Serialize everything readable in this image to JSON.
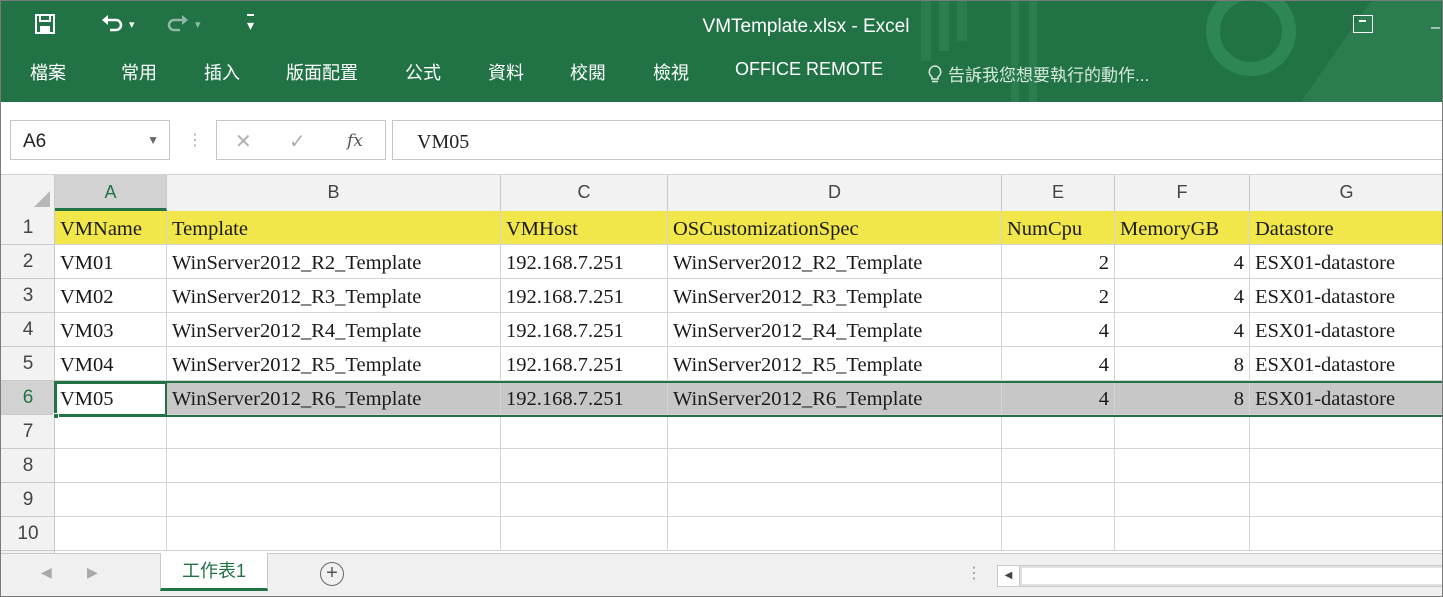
{
  "window": {
    "title": "VMTemplate.xlsx - Excel",
    "quick_access": {
      "save_icon": "save-icon",
      "undo_icon": "undo-icon",
      "redo_icon": "redo-icon",
      "customize": "▾"
    },
    "restore_icon": "restore-window-icon",
    "minimize_glyph": "–"
  },
  "ribbon_tabs": [
    {
      "label": "檔案"
    },
    {
      "label": "常用"
    },
    {
      "label": "插入"
    },
    {
      "label": "版面配置"
    },
    {
      "label": "公式"
    },
    {
      "label": "資料"
    },
    {
      "label": "校閱"
    },
    {
      "label": "檢視"
    },
    {
      "label": "OFFICE REMOTE"
    }
  ],
  "tell_me": {
    "icon": "lightbulb-icon",
    "placeholder": "告訴我您想要執行的動作..."
  },
  "formula_bar": {
    "name_box": "A6",
    "cancel_glyph": "✕",
    "enter_glyph": "✓",
    "fx_label": "fx",
    "content": "VM05"
  },
  "columns": [
    "A",
    "B",
    "C",
    "D",
    "E",
    "F",
    "G"
  ],
  "selected_column": "A",
  "row_numbers": [
    "1",
    "2",
    "3",
    "4",
    "5",
    "6",
    "7",
    "8",
    "9",
    "10"
  ],
  "selected_row": 6,
  "rows": [
    [
      "VMName",
      "Template",
      "VMHost",
      "OSCustomizationSpec",
      "NumCpu",
      "MemoryGB",
      "Datastore"
    ],
    [
      "VM01",
      "WinServer2012_R2_Template",
      "192.168.7.251",
      "WinServer2012_R2_Template",
      "2",
      "4",
      "ESX01-datastore"
    ],
    [
      "VM02",
      "WinServer2012_R3_Template",
      "192.168.7.251",
      "WinServer2012_R3_Template",
      "2",
      "4",
      "ESX01-datastore"
    ],
    [
      "VM03",
      "WinServer2012_R4_Template",
      "192.168.7.251",
      "WinServer2012_R4_Template",
      "4",
      "4",
      "ESX01-datastore"
    ],
    [
      "VM04",
      "WinServer2012_R5_Template",
      "192.168.7.251",
      "WinServer2012_R5_Template",
      "4",
      "8",
      "ESX01-datastore"
    ],
    [
      "VM05",
      "WinServer2012_R6_Template",
      "192.168.7.251",
      "WinServer2012_R6_Template",
      "4",
      "8",
      "ESX01-datastore"
    ]
  ],
  "sheet_tabs": [
    {
      "label": "工作表1",
      "active": true
    }
  ],
  "colors": {
    "excel_green": "#217346",
    "header_fill": "#f1e64a",
    "selection_fill": "#c7c7c7"
  }
}
